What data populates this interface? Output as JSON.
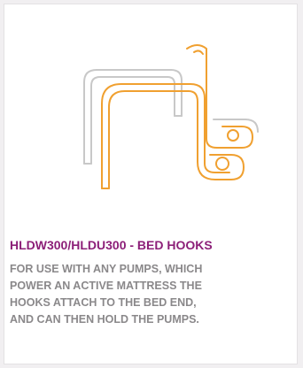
{
  "product": {
    "title": "HLDW300/HLDU300 - BED HOOKS",
    "description_lines": [
      "FOR USE WITH ANY PUMPS, WHICH",
      "POWER AN ACTIVE MATTRESS THE",
      "HOOKS ATTACH TO THE BED END,",
      "AND CAN THEN HOLD THE PUMPS."
    ],
    "image_icon": "bed-hooks-product-image"
  },
  "colors": {
    "background": "#f1eff1",
    "card": "#ffffff",
    "title": "#8c1f78",
    "description": "#8a888a",
    "hook_orange": "#f0a030",
    "hook_grey": "#c8c8c8"
  }
}
